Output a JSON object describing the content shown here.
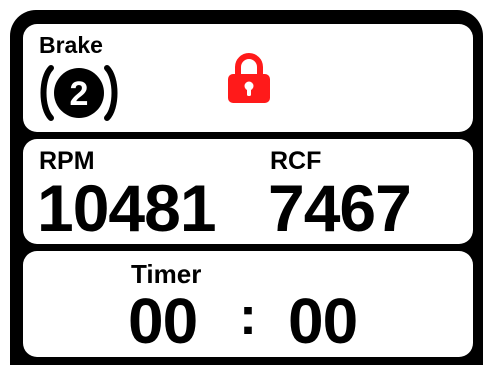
{
  "brake": {
    "label": "Brake",
    "level": "2",
    "icon": "brake-level-icon",
    "lock_icon": "lock-icon",
    "lock_color": "#ff1a1a"
  },
  "speed": {
    "rpm_label": "RPM",
    "rpm_value": "10481",
    "rcf_label": "RCF",
    "rcf_value": "7467"
  },
  "timer": {
    "label": "Timer",
    "minutes": "00",
    "separator": ":",
    "seconds": "00"
  }
}
